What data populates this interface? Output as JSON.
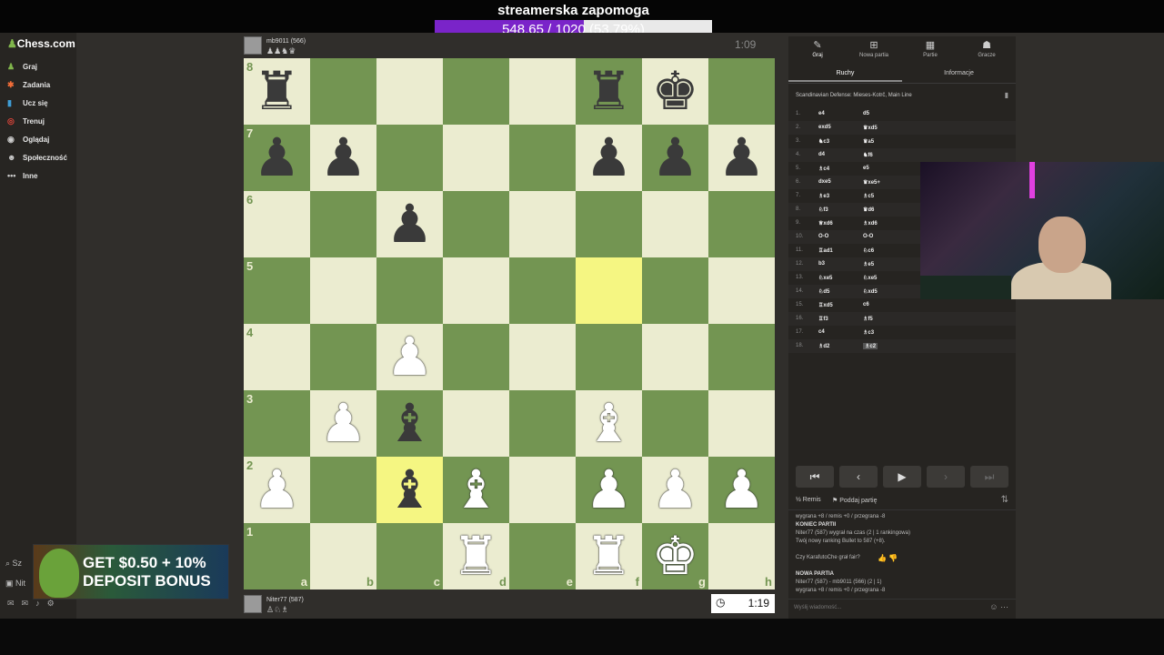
{
  "stream": {
    "title": "streamerska zapomoga",
    "goal_text": "548.65 / 1020 (53.79%)",
    "goal_progress": 0.5379
  },
  "sidebar": {
    "logo": "Chess.com",
    "items": [
      {
        "label": "Graj",
        "icon": "pawn-icon"
      },
      {
        "label": "Zadania",
        "icon": "puzzle-icon"
      },
      {
        "label": "Ucz się",
        "icon": "book-icon"
      },
      {
        "label": "Trenuj",
        "icon": "target-icon"
      },
      {
        "label": "Oglądaj",
        "icon": "binoculars-icon"
      },
      {
        "label": "Społeczność",
        "icon": "people-icon"
      },
      {
        "label": "Inne",
        "icon": "more-icon"
      }
    ],
    "bottom1": "Sz",
    "bottom2": "Nit"
  },
  "ad": {
    "line1": "GET $0.50 + 10%",
    "line2": "DEPOSIT BONUS"
  },
  "top_player": {
    "name": "mb9011 (566)",
    "captured": "♟♟♞♛",
    "clock": "1:09"
  },
  "bottom_player": {
    "name": "Niter77 (587)",
    "captured": "♙♘♗",
    "clock": "1:19"
  },
  "board": {
    "ranks": [
      "8",
      "7",
      "6",
      "5",
      "4",
      "3",
      "2",
      "1"
    ],
    "files": [
      "a",
      "b",
      "c",
      "d",
      "e",
      "f",
      "g",
      "h"
    ],
    "highlights": [
      "f5",
      "c2"
    ],
    "pieces": {
      "a8": "b-rook",
      "f8": "b-rook",
      "g8": "b-king",
      "a7": "b-pawn",
      "b7": "b-pawn",
      "f7": "b-pawn",
      "g7": "b-pawn",
      "h7": "b-pawn",
      "c6": "b-pawn",
      "c4": "w-pawn",
      "b3": "w-pawn",
      "c3": "b-bishop",
      "f3": "w-bishop",
      "a2": "w-pawn",
      "c2": "b-bishop",
      "d2": "w-bishop",
      "f2": "w-pawn",
      "g2": "w-pawn",
      "h2": "w-pawn",
      "d1": "w-rook",
      "f1": "w-rook",
      "g1": "w-king"
    }
  },
  "panel": {
    "tabs": [
      {
        "label": "Graj",
        "icon": "play-icon"
      },
      {
        "label": "Nowa partia",
        "icon": "plus-icon"
      },
      {
        "label": "Partie",
        "icon": "board-icon"
      },
      {
        "label": "Gracze",
        "icon": "players-icon"
      }
    ],
    "subtabs": [
      "Ruchy",
      "Informacje"
    ],
    "opening": "Scandinavian Defense: Mieses-Kotrč, Main Line",
    "moves": [
      {
        "n": "1.",
        "w": "e4",
        "b": "d5"
      },
      {
        "n": "2.",
        "w": "exd5",
        "b": "♛xd5"
      },
      {
        "n": "3.",
        "w": "♞c3",
        "b": "♛a5"
      },
      {
        "n": "4.",
        "w": "d4",
        "b": "♞f6"
      },
      {
        "n": "5.",
        "w": "♗c4",
        "b": "e5"
      },
      {
        "n": "6.",
        "w": "dxe5",
        "b": "♛xe5+"
      },
      {
        "n": "7.",
        "w": "♗e3",
        "b": "♗c5"
      },
      {
        "n": "8.",
        "w": "♘f3",
        "b": "♛d6"
      },
      {
        "n": "9.",
        "w": "♕xd6",
        "b": "♗xd6"
      },
      {
        "n": "10.",
        "w": "O-O",
        "b": "O-O"
      },
      {
        "n": "11.",
        "w": "♖ad1",
        "b": "♘c6"
      },
      {
        "n": "12.",
        "w": "b3",
        "b": "♗e5"
      },
      {
        "n": "13.",
        "w": "♘xe5",
        "b": "♘xe5"
      },
      {
        "n": "14.",
        "w": "♘d5",
        "b": "♘xd5"
      },
      {
        "n": "15.",
        "w": "♖xd5",
        "b": "c6"
      },
      {
        "n": "16.",
        "w": "♖f3",
        "b": "♗f5"
      },
      {
        "n": "17.",
        "w": "c4",
        "b": "♗c3"
      },
      {
        "n": "18.",
        "w": "♗d2",
        "b": "♗c2"
      }
    ],
    "draw": "Remis",
    "resign": "Poddaj partię",
    "chat": [
      {
        "t": "wygrana +8 / remis +0 / przegrana -8",
        "h": false
      },
      {
        "t": "KONIEC PARTII",
        "h": true
      },
      {
        "t": "Niter77 (587) wygrał na czas (2 | 1 rankingowa)",
        "h": false
      },
      {
        "t": "Twój nowy ranking Bullet to 587 (+8).",
        "h": false
      },
      {
        "t": "",
        "h": false
      },
      {
        "t": "Czy KarafutoChe grał fair?",
        "h": false
      },
      {
        "t": "",
        "h": false
      },
      {
        "t": "NOWA PARTIA",
        "h": true
      },
      {
        "t": "Niter77 (587) - mb9011 (566) (2 | 1)",
        "h": false
      },
      {
        "t": "wygrana +8 / remis +0 / przegrana -8",
        "h": false
      }
    ],
    "chat_placeholder": "Wyślij wiadomość..."
  }
}
